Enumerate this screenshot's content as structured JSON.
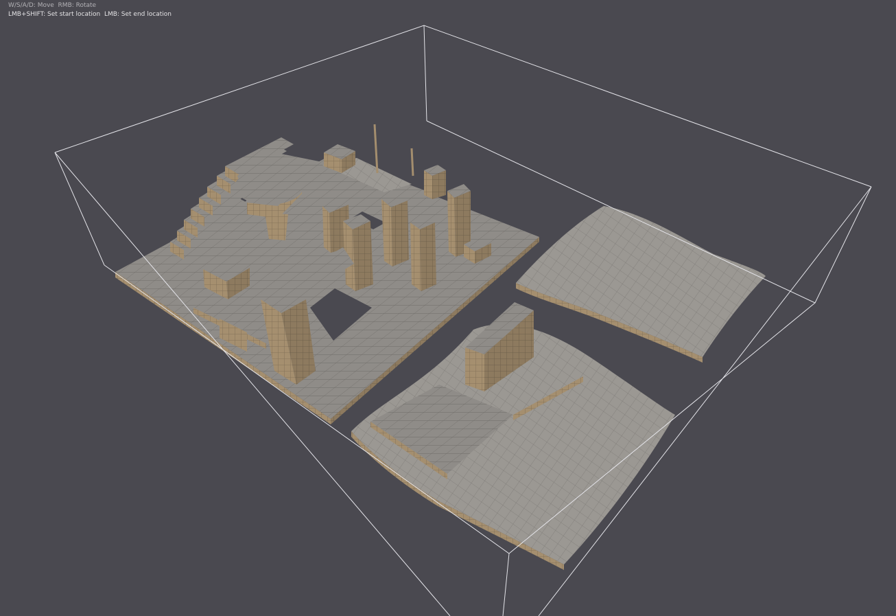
{
  "help": {
    "move_hint": "W/S/A/D: Move  RMB: Rotate",
    "location_hint": "LMB+SHIFT: Set start location  LMB: Set end location"
  },
  "scene": {
    "background_color": "#4a4950",
    "bounds_color": "#e8e8ec",
    "mesh_top_color": "#8f8c88",
    "mesh_side_color": "#a48e6e",
    "grid_line_color": "#6d6a66",
    "navmesh_color": "#9a9690"
  }
}
